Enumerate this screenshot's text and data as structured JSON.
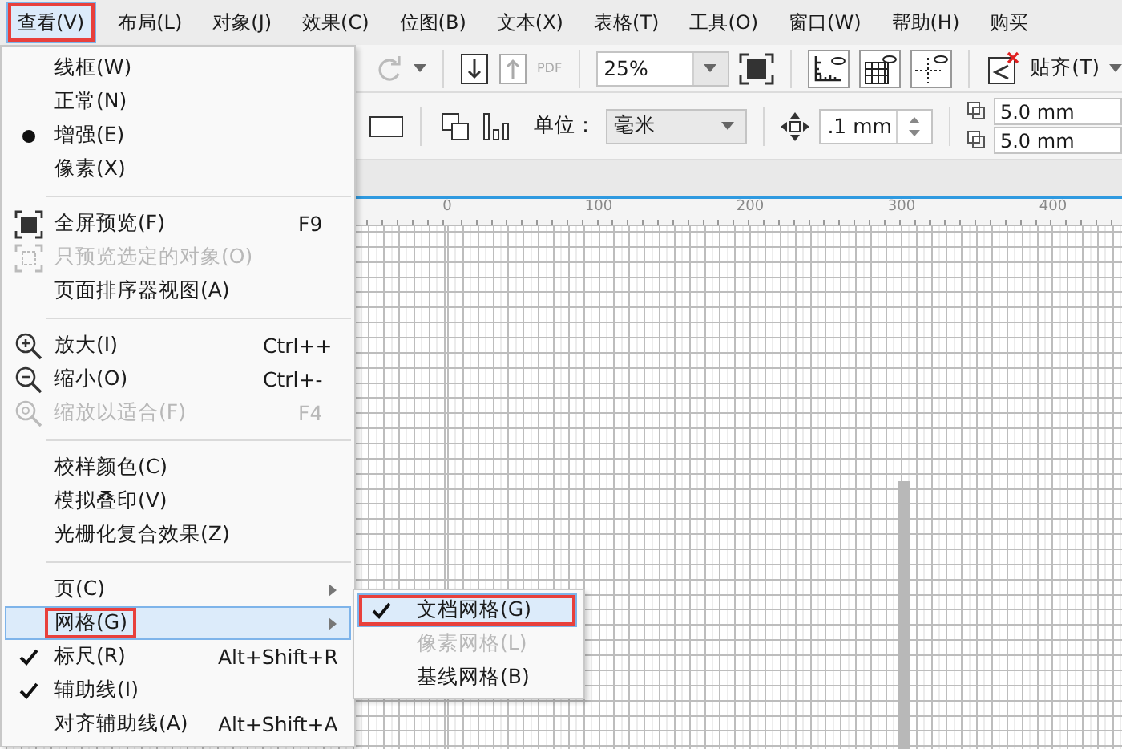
{
  "menubar": [
    {
      "label": "查看(V)",
      "selected": true,
      "outlined": true
    },
    {
      "label": "布局(L)",
      "selected": false,
      "outlined": false
    },
    {
      "label": "对象(J)",
      "selected": false,
      "outlined": false
    },
    {
      "label": "效果(C)",
      "selected": false,
      "outlined": false
    },
    {
      "label": "位图(B)",
      "selected": false,
      "outlined": false
    },
    {
      "label": "文本(X)",
      "selected": false,
      "outlined": false
    },
    {
      "label": "表格(T)",
      "selected": false,
      "outlined": false
    },
    {
      "label": "工具(O)",
      "selected": false,
      "outlined": false
    },
    {
      "label": "窗口(W)",
      "selected": false,
      "outlined": false
    },
    {
      "label": "帮助(H)",
      "selected": false,
      "outlined": false
    },
    {
      "label": "购买",
      "selected": false,
      "outlined": false
    }
  ],
  "toolbar": {
    "pdf_label": "PDF",
    "zoom": "25%",
    "snap_label": "贴齐(T)"
  },
  "property_bar": {
    "unit_label": "单位：",
    "unit": "毫米",
    "nudge": ".1 mm",
    "dup_x": "5.0 mm",
    "dup_y": "5.0 mm"
  },
  "ruler": {
    "labels": [
      "0",
      "100",
      "200",
      "300",
      "400"
    ]
  },
  "view_menu": {
    "sections": [
      [
        {
          "kind": "plain",
          "label": "线框(W)",
          "checked": false,
          "disabled": false,
          "selected": false,
          "outlined": false
        },
        {
          "kind": "plain",
          "label": "正常(N)",
          "checked": false,
          "disabled": false,
          "selected": false,
          "outlined": false
        },
        {
          "kind": "radio",
          "label": "增强(E)",
          "checked": true,
          "disabled": false,
          "selected": false,
          "outlined": false
        },
        {
          "kind": "plain",
          "label": "像素(X)",
          "checked": false,
          "disabled": false,
          "selected": false,
          "outlined": false
        }
      ],
      [
        {
          "kind": "fullscreen",
          "label": "全屏预览(F)",
          "shortcut": "F9",
          "checked": false,
          "disabled": false,
          "selected": false,
          "outlined": false
        },
        {
          "kind": "selection",
          "label": "只预览选定的对象(O)",
          "checked": false,
          "disabled": true,
          "selected": false,
          "outlined": false
        },
        {
          "kind": "plain",
          "label": "页面排序器视图(A)",
          "checked": false,
          "disabled": false,
          "selected": false,
          "outlined": false
        }
      ],
      [
        {
          "kind": "zoomin",
          "label": "放大(I)",
          "shortcut": "Ctrl++",
          "checked": false,
          "disabled": false,
          "selected": false,
          "outlined": false
        },
        {
          "kind": "zoomout",
          "label": "缩小(O)",
          "shortcut": "Ctrl+-",
          "checked": false,
          "disabled": false,
          "selected": false,
          "outlined": false
        },
        {
          "kind": "zoomfit",
          "label": "缩放以适合(F)",
          "shortcut": "F4",
          "checked": false,
          "disabled": true,
          "selected": false,
          "outlined": false
        }
      ],
      [
        {
          "kind": "plain",
          "label": "校样颜色(C)",
          "checked": false,
          "disabled": false,
          "selected": false,
          "outlined": false
        },
        {
          "kind": "plain",
          "label": "模拟叠印(V)",
          "checked": false,
          "disabled": false,
          "selected": false,
          "outlined": false
        },
        {
          "kind": "plain",
          "label": "光栅化复合效果(Z)",
          "checked": false,
          "disabled": false,
          "selected": false,
          "outlined": false
        }
      ],
      [
        {
          "kind": "submenu",
          "label": "页(C)",
          "checked": false,
          "disabled": false,
          "selected": false,
          "outlined": false
        },
        {
          "kind": "submenu",
          "label": "网格(G)",
          "checked": false,
          "disabled": false,
          "selected": true,
          "outlined": true
        },
        {
          "kind": "check",
          "label": "标尺(R)",
          "shortcut": "Alt+Shift+R",
          "checked": true,
          "disabled": false,
          "selected": false,
          "outlined": false
        },
        {
          "kind": "check",
          "label": "辅助线(I)",
          "checked": true,
          "disabled": false,
          "selected": false,
          "outlined": false
        },
        {
          "kind": "check",
          "label": "对齐辅助线(A)",
          "shortcut": "Alt+Shift+A",
          "checked": false,
          "disabled": false,
          "selected": false,
          "outlined": false
        }
      ]
    ]
  },
  "grid_submenu": [
    {
      "label": "文档网格(G)",
      "checked": true,
      "disabled": false,
      "selected": true,
      "outlined": true
    },
    {
      "label": "像素网格(L)",
      "checked": false,
      "disabled": true,
      "selected": false,
      "outlined": false
    },
    {
      "label": "基线网格(B)",
      "checked": false,
      "disabled": false,
      "selected": false,
      "outlined": false
    }
  ]
}
